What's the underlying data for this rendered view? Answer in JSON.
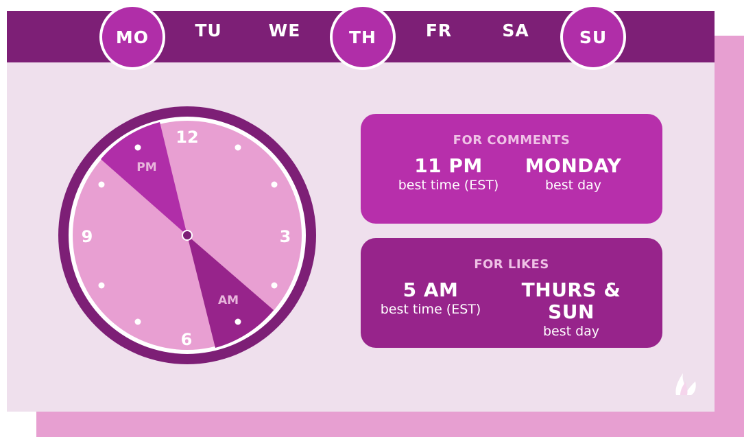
{
  "days": [
    {
      "label": "MO",
      "highlighted": true
    },
    {
      "label": "TU",
      "highlighted": false
    },
    {
      "label": "WE",
      "highlighted": false
    },
    {
      "label": "TH",
      "highlighted": true
    },
    {
      "label": "FR",
      "highlighted": false
    },
    {
      "label": "SA",
      "highlighted": false
    },
    {
      "label": "SU",
      "highlighted": true
    }
  ],
  "clock": {
    "numerals": {
      "twelve": "12",
      "three": "3",
      "six": "6",
      "nine": "9"
    },
    "pm_label": "PM",
    "am_label": "AM"
  },
  "comments": {
    "heading": "FOR COMMENTS",
    "time_value": "11 PM",
    "time_caption": "best time (EST)",
    "day_value": "MONDAY",
    "day_caption": "best day"
  },
  "likes": {
    "heading": "FOR LIKES",
    "time_value": "5 AM",
    "time_caption": "best time (EST)",
    "day_value": "THURS & SUN",
    "day_caption": "best day"
  },
  "colors": {
    "top_bar": "#7d1f76",
    "highlight": "#b02ea8",
    "comments_panel": "#b72fab",
    "likes_panel": "#97248b",
    "card_bg": "#efe0ed",
    "clock_face": "#e89fd2"
  },
  "icons": {
    "brand_logo": "flame-logo-icon"
  }
}
